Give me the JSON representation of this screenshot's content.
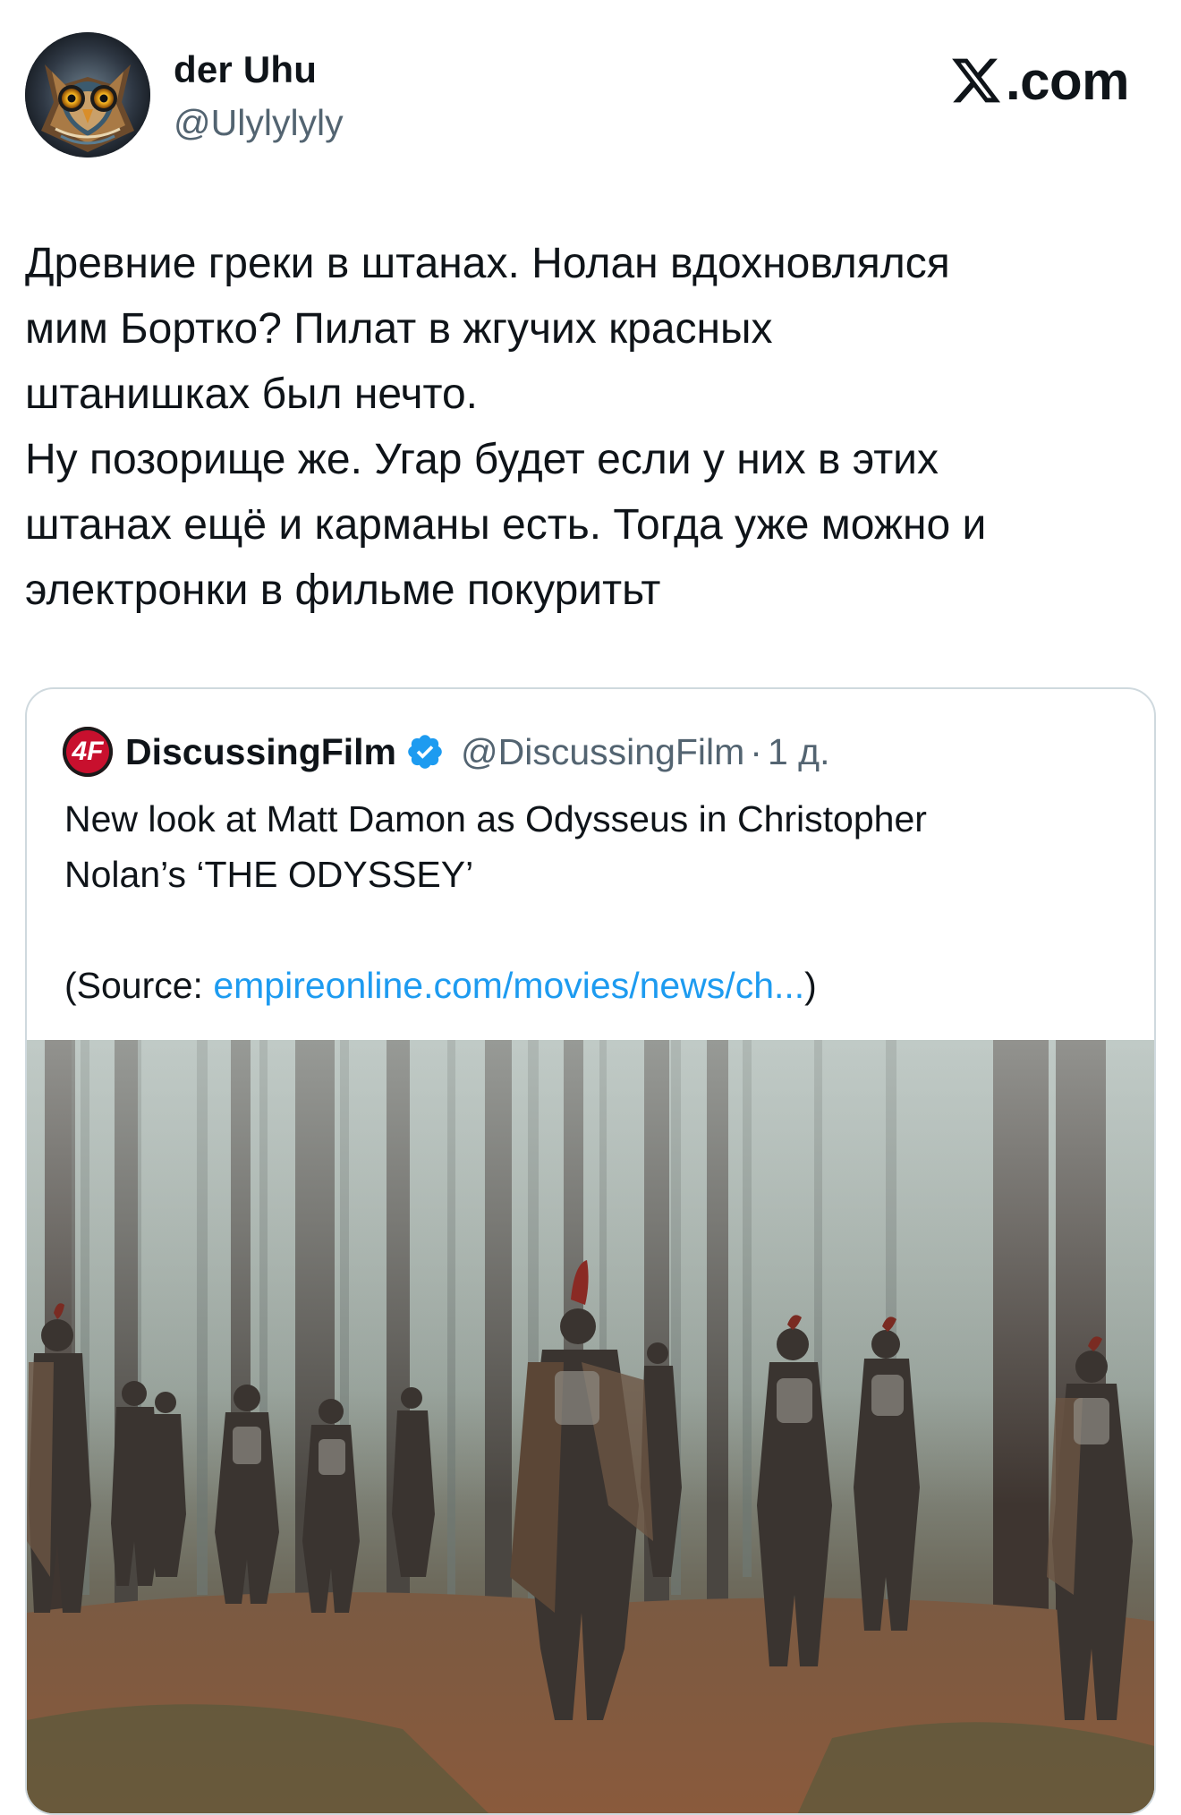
{
  "header": {
    "user_name": "der Uhu",
    "user_handle": "@Ulylylyly",
    "avatar_icon": "owl-avatar-icon",
    "brand_text": ".com",
    "brand_icon": "x-logo-icon"
  },
  "tweet": {
    "lines": [
      "Древние греки в штанах. Нолан вдохновлялся",
      "мим Бортко? Пилат в жгучих красных",
      "штанишках был нечто.",
      "Ну позорище же. Угар будет если у них в этих",
      "штанах ещё и карманы есть. Тогда уже можно и",
      "электронки в фильме покуритьт"
    ]
  },
  "quote": {
    "logo_text": "4F",
    "name": "DiscussingFilm",
    "verified_icon": "verified-badge-icon",
    "handle": "@DiscussingFilm",
    "separator": "·",
    "time": "1 д.",
    "line1": "New look at Matt Damon as Odysseus in Christopher",
    "line2": "Nolan’s ‘THE ODYSSEY’",
    "source_prefix": "(Source: ",
    "source_link": "empireonline.com/movies/news/ch...",
    "source_suffix": ")",
    "photo_icon": "film-still-image"
  },
  "colors": {
    "text_primary": "#0f1419",
    "text_secondary": "#536471",
    "link": "#1d9bf0",
    "border": "#cfd9de",
    "verified": "#1d9bf0",
    "logo_red": "#c8102e"
  }
}
